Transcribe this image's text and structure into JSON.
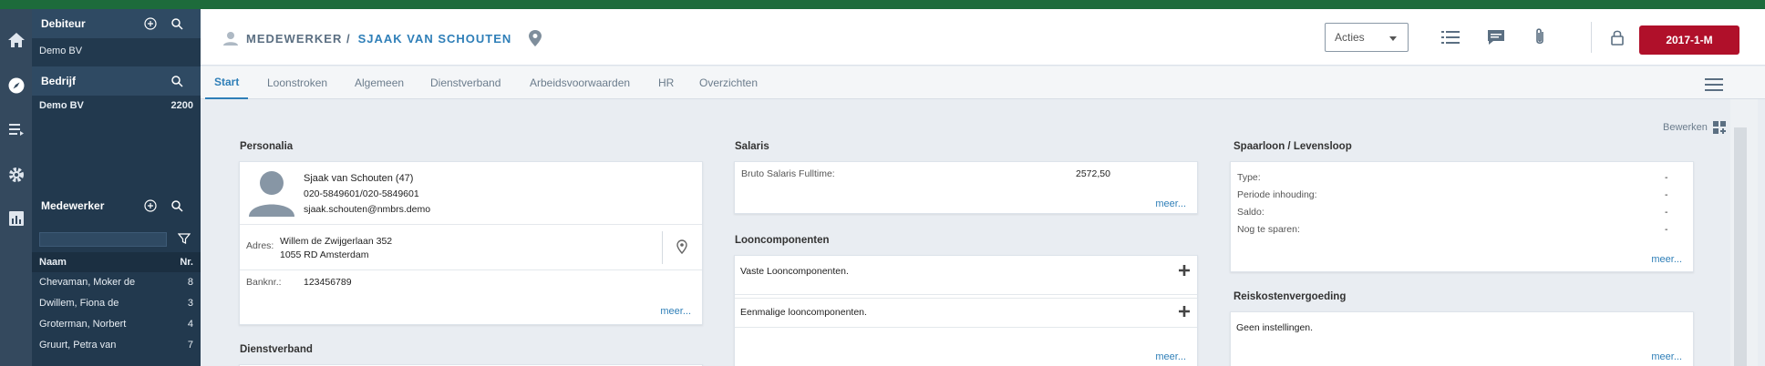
{
  "rail": {
    "icons": [
      "home-icon",
      "compass-icon",
      "list-icon",
      "gear-icon",
      "chart-icon"
    ]
  },
  "sidebar": {
    "debiteur": {
      "title": "Debiteur",
      "value": "Demo BV"
    },
    "bedrijf": {
      "title": "Bedrijf",
      "name": "Demo BV",
      "number": "2200"
    },
    "medewerker": {
      "title": "Medewerker",
      "col_name": "Naam",
      "col_nr": "Nr.",
      "rows": [
        {
          "name": "Chevaman, Moker de",
          "nr": "8"
        },
        {
          "name": "Dwillem, Fiona de",
          "nr": "3"
        },
        {
          "name": "Groterman, Norbert",
          "nr": "4"
        },
        {
          "name": "Gruurt, Petra van",
          "nr": "7"
        }
      ]
    }
  },
  "header": {
    "crumb_prefix": "MEDEWERKER /",
    "crumb_name": "SJAAK VAN SCHOUTEN",
    "acties_label": "Acties",
    "period_label": "2017-1-M"
  },
  "tabs": [
    "Start",
    "Loonstroken",
    "Algemeen",
    "Dienstverband",
    "Arbeidsvoorwaarden",
    "HR",
    "Overzichten"
  ],
  "bewerken_label": "Bewerken",
  "personalia": {
    "title": "Personalia",
    "name": "Sjaak van Schouten (47)",
    "phone": "020-5849601/020-5849601",
    "email": "sjaak.schouten@nmbrs.demo",
    "adres_label": "Adres:",
    "adres_line1": "Willem de Zwijgerlaan 352",
    "adres_line2": "1055 RD Amsterdam",
    "bank_label": "Banknr.:",
    "bank_value": "123456789",
    "meer": "meer..."
  },
  "dienstverband": {
    "title": "Dienstverband"
  },
  "salaris": {
    "title": "Salaris",
    "label": "Bruto Salaris Fulltime:",
    "value": "2572,50",
    "meer": "meer..."
  },
  "looncomponenten": {
    "title": "Looncomponenten",
    "vaste": "Vaste Looncomponenten.",
    "eenmalige": "Eenmalige looncomponenten.",
    "meer": "meer..."
  },
  "spaarloon": {
    "title": "Spaarloon / Levensloop",
    "rows": [
      {
        "label": "Type:",
        "value": "-"
      },
      {
        "label": "Periode inhouding:",
        "value": "-"
      },
      {
        "label": "Saldo:",
        "value": "-"
      },
      {
        "label": "Nog te sparen:",
        "value": "-"
      }
    ],
    "meer": "meer..."
  },
  "reiskosten": {
    "title": "Reiskostenvergoeding",
    "text": "Geen instellingen.",
    "meer": "meer..."
  },
  "colors": {
    "accent": "#2f7fb8",
    "brand_green": "#1d6b3b",
    "sidebar": "#22394e",
    "period": "#b0102a"
  }
}
